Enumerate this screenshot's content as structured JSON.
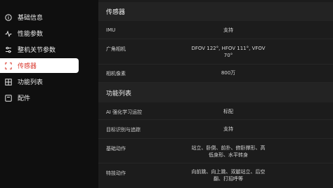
{
  "sidebar": {
    "items": [
      {
        "label": "基础信息",
        "icon": "info-circle-icon",
        "active": false
      },
      {
        "label": "性能参数",
        "icon": "pulse-icon",
        "active": false
      },
      {
        "label": "整机关节参数",
        "icon": "sliders-icon",
        "active": false
      },
      {
        "label": "传感器",
        "icon": "scan-frame-icon",
        "active": true
      },
      {
        "label": "功能列表",
        "icon": "grid-icon",
        "active": false
      },
      {
        "label": "配件",
        "icon": "box-icon",
        "active": false
      }
    ]
  },
  "colors": {
    "accent": "#d93a2f",
    "panel": "#1c1c1c",
    "section_header": "#232323",
    "sidebar_bg": "#0f0f0f"
  },
  "sections": {
    "sensors": {
      "title": "传感器",
      "rows": [
        {
          "label": "IMU",
          "value": "支持"
        },
        {
          "label": "广角相机",
          "value": "DFOV 122°, HFOV 111°, VFOV 70°"
        },
        {
          "label": "相机像素",
          "value": "800万"
        }
      ]
    },
    "features": {
      "title": "功能列表",
      "rows": [
        {
          "label": "AI 强化学习运控",
          "value": "标配"
        },
        {
          "label": "目标识别与追踪",
          "value": "支持"
        },
        {
          "label": "基础动作",
          "value": "站立、卧倒、前扑、俯卧撑形、高低身形、水平转身"
        },
        {
          "label": "特技动作",
          "value": "向前跳、向上跳、双腿站立、后空翻、打招呼等"
        }
      ]
    }
  }
}
